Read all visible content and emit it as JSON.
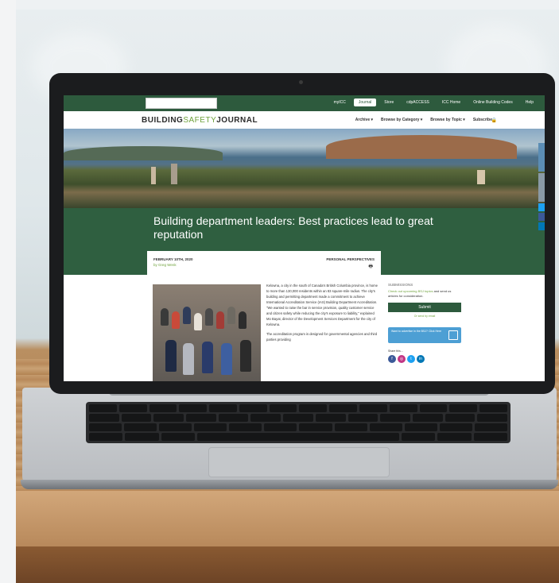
{
  "site": {
    "topnav": [
      "myICC",
      "Journal",
      "Store",
      "cdpACCESS",
      "ICC Home",
      "Online Building Codes",
      "Help"
    ],
    "topnav_active": "Journal",
    "logo": {
      "part1": "BUILDING",
      "part2": "SAFETY",
      "part3": "JOURNAL"
    },
    "mainnav": [
      "Archive ▾",
      "Browse by Category ▾",
      "Browse by Topic ▾",
      "Subscribe"
    ],
    "headline": "Building department leaders: Best practices lead to great reputation",
    "date": "FEBRUARY 10TH, 2020",
    "byline": "by Greg Wenk",
    "category": "PERSONAL PERSPECTIVES",
    "paragraph1": "Kelowna, a city in the south of Canada's British Columbia province, is home to more than 130,000 residents within an 83 square-mile radius. The city's building and permitting department made a commitment to achieve International Accreditation Service (IAS) Building Department Accreditation. \"We wanted to raise the bar in service provision, quality customer service and citizen safety while reducing the city's exposure to liability,\" explained Mo Bayat, director of the Development Services Department for the city of Kelowna.",
    "paragraph2": "The accreditation program is designed for governmental agencies and third parties providing",
    "sidebar": {
      "title": "SUBMISSIONS",
      "text_link": "Check out upcoming BSJ topics",
      "text_rest": " and send us articles for consideration.",
      "submit": "Submit",
      "email": "Or send by email",
      "ad": "Want to advertise in the BSJ? Click Here",
      "share": "Share this..."
    }
  },
  "colors": {
    "brand_green": "#2d5a3d",
    "accent_green": "#6fa23c",
    "ad_blue": "#4d9fd4"
  }
}
